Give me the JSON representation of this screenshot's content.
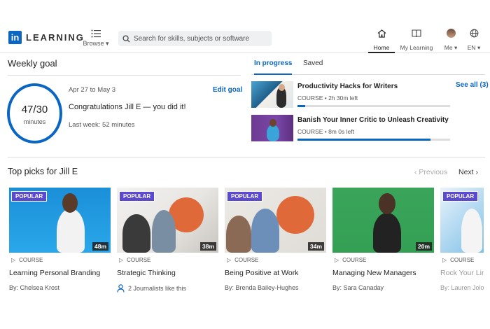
{
  "header": {
    "logo_in": "in",
    "logo_text": "LEARNING",
    "browse_label": "Browse",
    "search_placeholder": "Search for skills, subjects or software",
    "nav": {
      "home": "Home",
      "my_learning": "My Learning",
      "me": "Me",
      "lang": "EN"
    }
  },
  "weekly_goal": {
    "title": "Weekly goal",
    "progress": "47/30",
    "unit": "minutes",
    "dates": "Apr 27 to May 3",
    "edit_label": "Edit goal",
    "message": "Congratulations Jill E — you did it!",
    "last_week": "Last week: 52 minutes"
  },
  "tabs": {
    "in_progress": "In progress",
    "saved": "Saved"
  },
  "see_all": "See all (3)",
  "in_progress": [
    {
      "title": "Productivity Hacks for Writers",
      "type": "COURSE",
      "time_left": "2h 30m left",
      "progress": 0.05
    },
    {
      "title": "Banish Your Inner Critic to Unleash Creativity",
      "type": "COURSE",
      "time_left": "8m 0s left",
      "progress": 0.87
    }
  ],
  "top_picks": {
    "title": "Top picks for Jill E",
    "previous": "Previous",
    "next": "Next",
    "cards": [
      {
        "badge": "POPULAR",
        "duration": "48m",
        "type": "COURSE",
        "title": "Learning Personal Branding",
        "byline": "By: Chelsea Krost"
      },
      {
        "badge": "POPULAR",
        "duration": "38m",
        "type": "COURSE",
        "title": "Strategic Thinking",
        "byline": "2 Journalists like this"
      },
      {
        "badge": "POPULAR",
        "duration": "34m",
        "type": "COURSE",
        "title": "Being Positive at Work",
        "byline": "By: Brenda Bailey-Hughes"
      },
      {
        "badge": "",
        "duration": "20m",
        "type": "COURSE",
        "title": "Managing New Managers",
        "byline": "By: Sara Canaday"
      },
      {
        "badge": "POPULAR",
        "duration": "",
        "type": "COURSE",
        "title": "Rock Your Link",
        "byline": "By: Lauren Jolo"
      }
    ]
  },
  "colors": {
    "accent": "#0a66c2",
    "badge": "#5b4acf"
  }
}
